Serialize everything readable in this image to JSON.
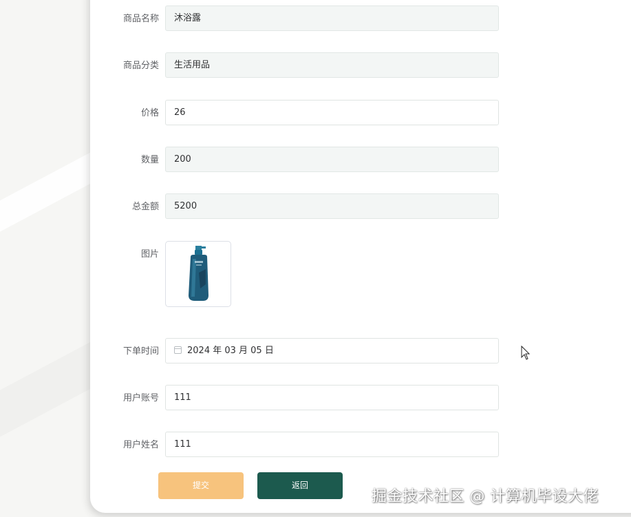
{
  "form": {
    "fields": [
      {
        "label": "商品名称",
        "value": "沐浴露",
        "disabled": true
      },
      {
        "label": "商品分类",
        "value": "生活用品",
        "disabled": true
      },
      {
        "label": "价格",
        "value": "26",
        "disabled": false
      },
      {
        "label": "数量",
        "value": "200",
        "disabled": true
      },
      {
        "label": "总金额",
        "value": "5200",
        "disabled": true
      }
    ],
    "image_label": "图片",
    "order_time": {
      "label": "下单时间",
      "value": "2024 年 03 月 05 日"
    },
    "account": {
      "label": "用户账号",
      "value": "111"
    },
    "username": {
      "label": "用户姓名",
      "value": "111"
    },
    "submit_label": "提交",
    "back_label": "返回"
  },
  "watermark": "掘金技术社区 @ 计算机毕设大佬",
  "colors": {
    "submit": "#f7c37d",
    "back": "#1c5a4e",
    "disabled_field": "#f3f6f5",
    "product_bottle": "#1f5c7a"
  },
  "icons": {
    "calendar": "calendar-icon",
    "cursor": "mouse-pointer-icon"
  }
}
